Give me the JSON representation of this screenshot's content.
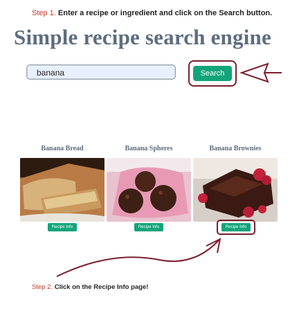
{
  "step1": {
    "label": "Step 1.",
    "text": "Enter a recipe or ingredient and click on the Search button."
  },
  "page": {
    "title": "Simple recipe search engine"
  },
  "search": {
    "value": "banana",
    "button_label": "Search"
  },
  "recipes": [
    {
      "title": "Banana Bread",
      "button_label": "Recipe Info"
    },
    {
      "title": "Banana Spheres",
      "button_label": "Recipe Info"
    },
    {
      "title": "Banana Brownies",
      "button_label": "Recipe Info"
    }
  ],
  "step2": {
    "label": "Step 2.",
    "text": "Click on the Recipe Info page!"
  },
  "colors": {
    "accent": "#12a47a",
    "highlight": "#7b1f2e",
    "step_label": "#c0392b",
    "title": "#5d6d7e"
  }
}
